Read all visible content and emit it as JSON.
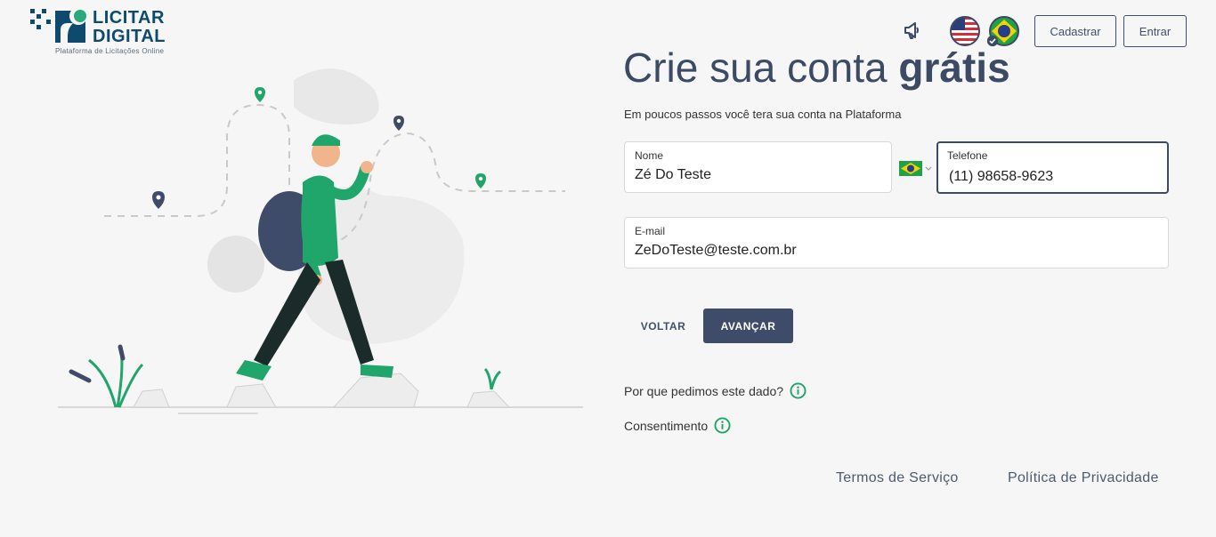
{
  "header": {
    "logo": {
      "brand_line1": "LICITAR",
      "brand_line2": "DIGITAL",
      "tagline": "Plataforma de Licitações Online"
    },
    "megaphone_icon": "megaphone-icon",
    "languages": [
      {
        "name": "us-flag-icon",
        "selected": false
      },
      {
        "name": "br-flag-icon",
        "selected": true
      }
    ],
    "signup_label": "Cadastrar",
    "login_label": "Entrar"
  },
  "form": {
    "title_regular": "Crie sua conta ",
    "title_bold": "grátis",
    "subtitle": "Em poucos passos você tera sua conta na Plataforma",
    "name": {
      "label": "Nome",
      "value": "Zé Do Teste"
    },
    "country_code_flag": "br-flag-icon",
    "phone": {
      "label": "Telefone",
      "value": "(11) 98658-9623"
    },
    "email": {
      "label": "E-mail",
      "value": "ZeDoTeste@teste.com.br"
    },
    "back_label": "VOLTAR",
    "next_label": "AVANÇAR",
    "why_label": "Por que pedimos este dado?",
    "consent_label": "Consentimento"
  },
  "footer": {
    "terms_label": "Termos de Serviço",
    "privacy_label": "Política de Privacidade"
  },
  "colors": {
    "primary": "#3f4c69",
    "accent_green": "#20a56b",
    "logo_blue": "#0e4a6e",
    "background": "#f6f6f6"
  }
}
